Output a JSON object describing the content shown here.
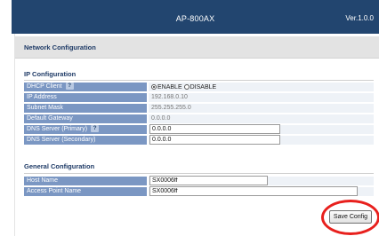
{
  "header": {
    "title": "AP-800AX",
    "version": "Ver.1.0.0"
  },
  "panel": {
    "title": "Network Configuration"
  },
  "ip_config": {
    "title": "IP Configuration",
    "dhcp": {
      "label": "DHCP Client",
      "help": "?",
      "options": [
        "ENABLE",
        "DISABLE"
      ],
      "selected": "ENABLE"
    },
    "ip_address": {
      "label": "IP Address",
      "value": "192.168.0.10"
    },
    "subnet_mask": {
      "label": "Subnet Mask",
      "value": "255.255.255.0"
    },
    "default_gateway": {
      "label": "Default Gateway",
      "value": "0.0.0.0"
    },
    "dns_primary": {
      "label": "DNS Server (Primary)",
      "help": "?",
      "value": "0.0.0.0"
    },
    "dns_secondary": {
      "label": "DNS Server (Secondary)",
      "value": "0.0.0.0"
    }
  },
  "general_config": {
    "title": "General Configuration",
    "host_name": {
      "label": "Host Name",
      "value": "SX0006ff"
    },
    "ap_name": {
      "label": "Access Point Name",
      "value": "SX0006ff"
    }
  },
  "actions": {
    "save_label": "Save Config"
  },
  "colors": {
    "topbar": "#22456f",
    "label_bg": "#7b97c3",
    "highlight": "#e8201d"
  }
}
